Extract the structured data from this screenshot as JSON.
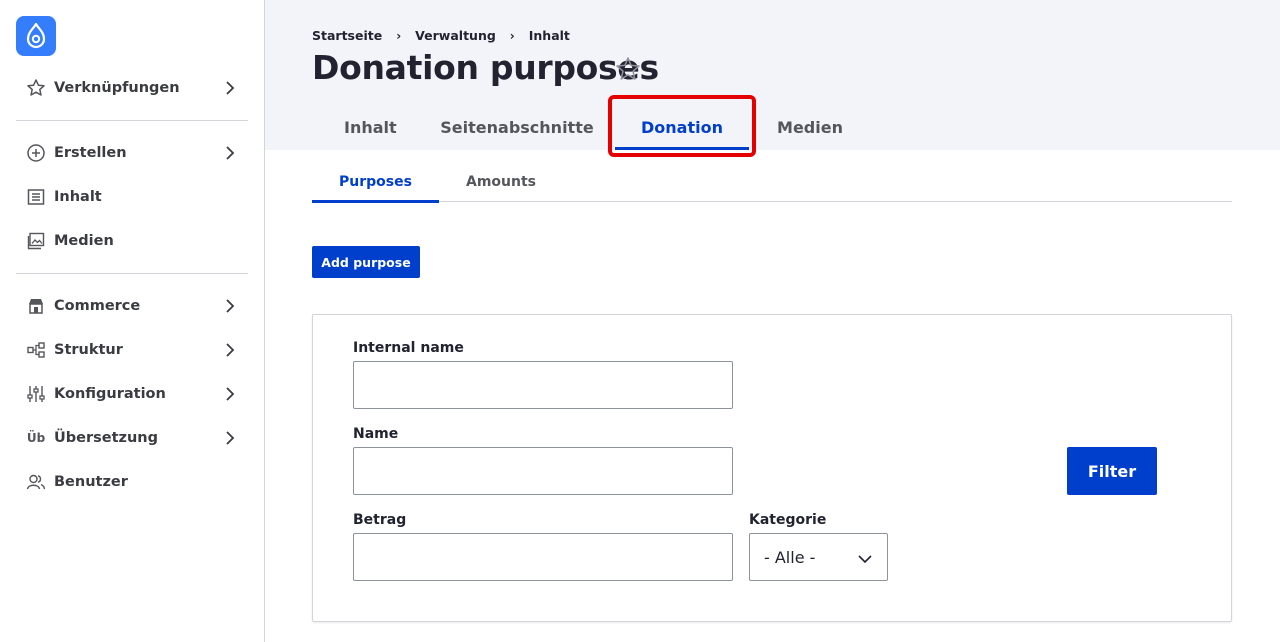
{
  "sidebar": {
    "items": [
      {
        "label": "Verknüpfungen",
        "icon": "star-icon"
      },
      {
        "label": "Erstellen",
        "icon": "plus-circle-icon"
      },
      {
        "label": "Inhalt",
        "icon": "document-list-icon"
      },
      {
        "label": "Medien",
        "icon": "image-icon"
      },
      {
        "label": "Commerce",
        "icon": "shop-icon"
      },
      {
        "label": "Struktur",
        "icon": "structure-icon"
      },
      {
        "label": "Konfiguration",
        "icon": "sliders-icon"
      },
      {
        "label": "Übersetzung",
        "icon": "translation-icon",
        "glyph": "Üb"
      },
      {
        "label": "Benutzer",
        "icon": "users-icon"
      }
    ]
  },
  "header": {
    "breadcrumb": [
      "Startseite",
      "Verwaltung",
      "Inhalt"
    ],
    "title": "Donation purposes",
    "star_glyph": "☆"
  },
  "primary_tabs": [
    {
      "label": "Inhalt",
      "active": false
    },
    {
      "label": "Seitenabschnitte",
      "active": false
    },
    {
      "label": "Donation",
      "active": true
    },
    {
      "label": "Medien",
      "active": false
    }
  ],
  "secondary_tabs": [
    {
      "label": "Purposes",
      "active": true
    },
    {
      "label": "Amounts",
      "active": false
    }
  ],
  "add_button_label": "Add purpose",
  "filters": {
    "internal_name_label": "Internal name",
    "internal_name_value": "",
    "name_label": "Name",
    "name_value": "",
    "amount_label": "Betrag",
    "amount_value": "",
    "category_label": "Kategorie",
    "category_selected": "- Alle -",
    "filter_button": "Filter"
  },
  "colors": {
    "accent": "#003ecc",
    "logo": "#347efe",
    "highlight": "#e40000",
    "header_bg": "#f3f4f9"
  }
}
